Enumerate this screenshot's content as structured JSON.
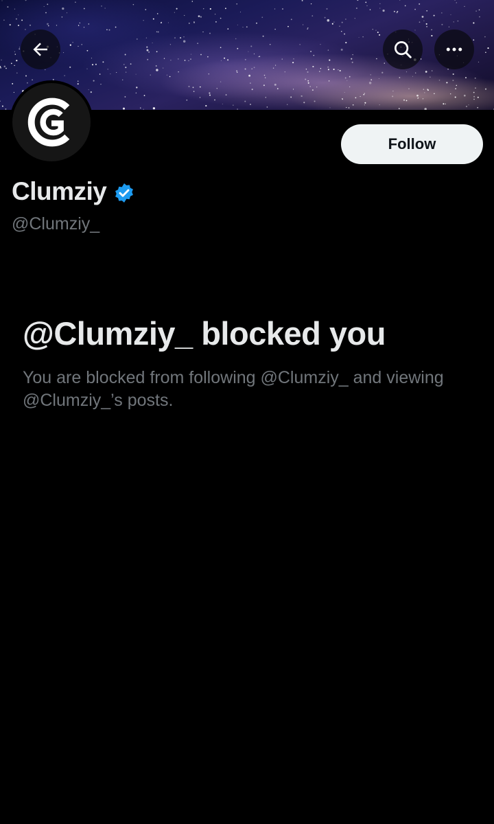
{
  "header": {
    "back_icon": "arrow-left-icon",
    "search_icon": "search-icon",
    "more_icon": "more-horizontal-icon"
  },
  "profile": {
    "display_name": "Clumziy",
    "handle": "@Clumziy_",
    "verified": true,
    "verified_color": "#1d9bf0",
    "avatar_icon": "clumziy-logo-icon"
  },
  "actions": {
    "follow_label": "Follow"
  },
  "blocked": {
    "title": "@Clumziy_ blocked you",
    "description": "You are blocked from following @Clumziy_ and viewing @Clumziy_’s posts."
  },
  "colors": {
    "background": "#000000",
    "primary_text": "#e7e9ea",
    "secondary_text": "#71767b",
    "follow_button_bg": "#eff3f4",
    "follow_button_text": "#0f1419"
  }
}
